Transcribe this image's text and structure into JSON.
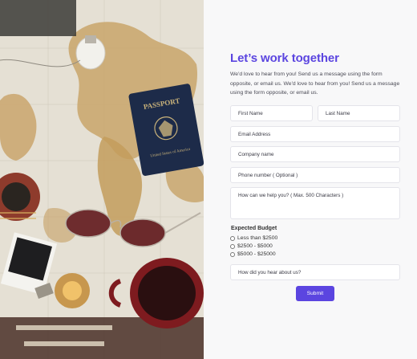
{
  "heading": "Let’s work together",
  "description": "We'd love to hear from you! Send us a message using the form opposite, or email us. We'd love to hear from you! Send us a message using the form opposite, or email us.",
  "form": {
    "first_name_placeholder": "First Name",
    "last_name_placeholder": "Last Name",
    "email_placeholder": "Email Address",
    "company_placeholder": "Company name",
    "phone_placeholder": "Phone number ( Optional )",
    "message_placeholder": "How can we help you? ( Max. 500 Characters )",
    "budget_label": "Expected Budget",
    "budget_options": [
      "Less than $2500",
      "$2500 - $5000",
      "$5000 - $25000"
    ],
    "referral_placeholder": "How did you hear about us?",
    "submit_label": "Submit"
  },
  "photo": {
    "passport_text": "PASSPORT",
    "passport_country": "United States of America"
  },
  "colors": {
    "accent": "#5b45e0",
    "page_bg": "#f8f8f9",
    "field_border": "#e4e4ea"
  }
}
